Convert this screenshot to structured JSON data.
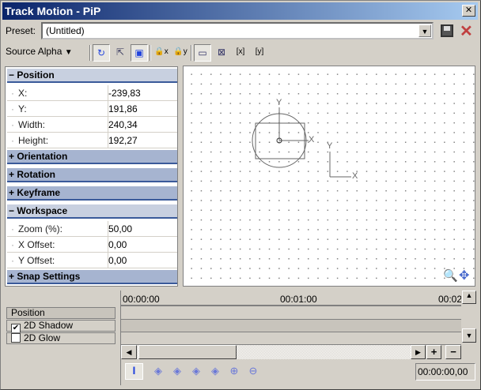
{
  "window": {
    "title": "Track Motion - PiP",
    "close": "✕"
  },
  "preset": {
    "label": "Preset:",
    "value": "(Untitled)"
  },
  "toolbar": {
    "source": "Source Alpha",
    "icons": [
      "rotate-icon",
      "move-icon",
      "3d-box-icon",
      "lock-x-icon",
      "lock-y-icon",
      "view-icon",
      "fit-icon",
      "x-box-icon",
      "y-box-icon"
    ]
  },
  "props": {
    "position": {
      "label": "Position",
      "rows": [
        {
          "k": "X:",
          "v": "-239,83"
        },
        {
          "k": "Y:",
          "v": "191,86"
        },
        {
          "k": "Width:",
          "v": "240,34"
        },
        {
          "k": "Height:",
          "v": "192,27"
        }
      ]
    },
    "orientation": "Orientation",
    "rotation": "Rotation",
    "keyframe": "Keyframe",
    "workspace": {
      "label": "Workspace",
      "rows": [
        {
          "k": "Zoom (%):",
          "v": "50,00"
        },
        {
          "k": "X Offset:",
          "v": "0,00"
        },
        {
          "k": "Y Offset:",
          "v": "0,00"
        }
      ]
    },
    "snap": "Snap Settings"
  },
  "canvas": {
    "axis_x": "X",
    "axis_y": "Y"
  },
  "tracks": [
    {
      "label": "Position",
      "checked": null
    },
    {
      "label": "2D Shadow",
      "checked": true
    },
    {
      "label": "2D Glow",
      "checked": false
    }
  ],
  "timeline": {
    "ticks": [
      "00:00:00",
      "00:01:00",
      "00:02"
    ],
    "time": "00:00:00,00",
    "plus": "+",
    "minus": "−"
  }
}
